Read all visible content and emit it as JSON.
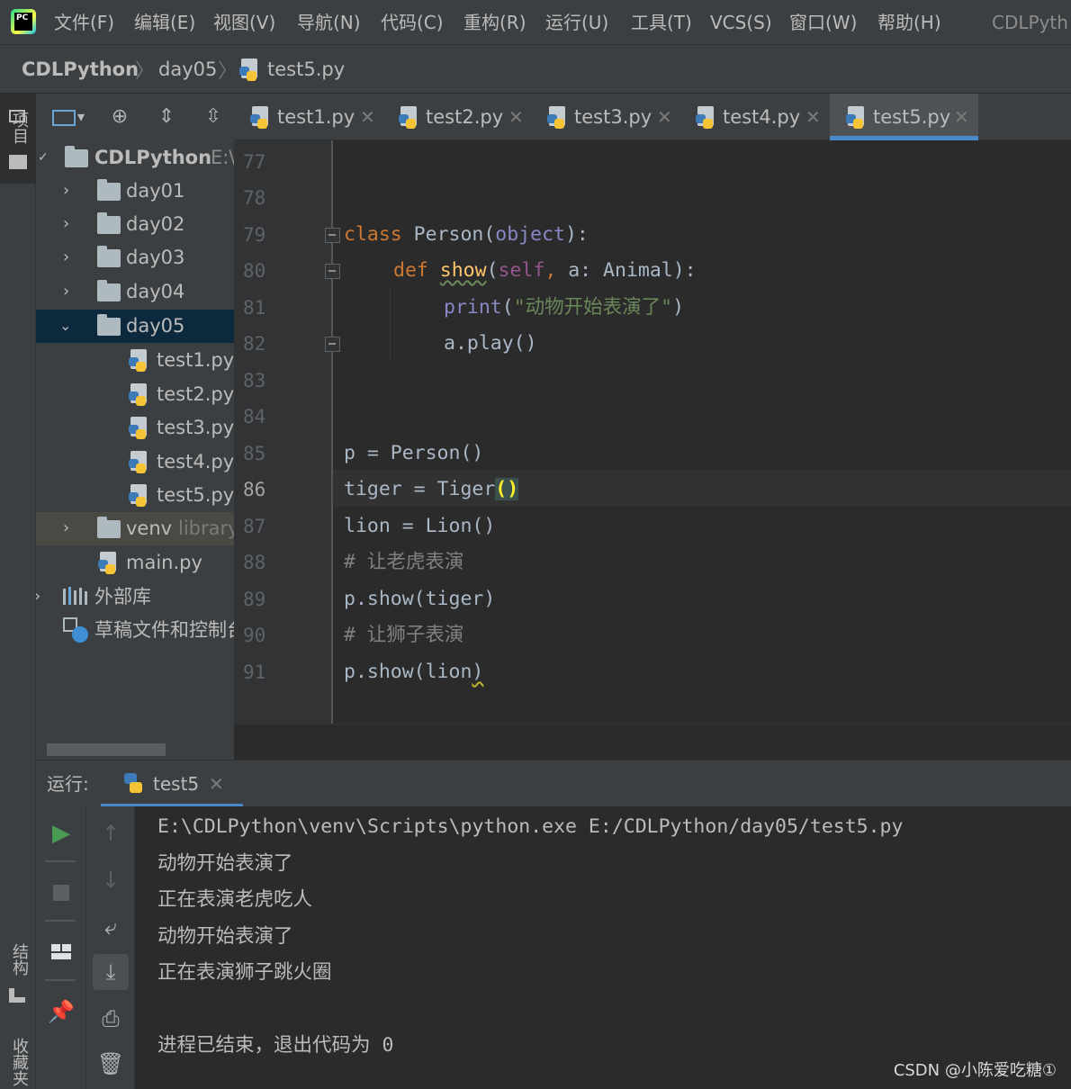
{
  "app": {
    "logo_text": "PC",
    "title": "CDLPyth"
  },
  "menu": [
    "文件(F)",
    "编辑(E)",
    "视图(V)",
    "导航(N)",
    "代码(C)",
    "重构(R)",
    "运行(U)",
    "工具(T)",
    "VCS(S)",
    "窗口(W)",
    "帮助(H)"
  ],
  "breadcrumb": [
    "CDLPython",
    "day05",
    "test5.py"
  ],
  "left_stripe": {
    "project": "项目",
    "structure": "结构",
    "bookmarks": "收藏夹"
  },
  "project_tree": {
    "root": {
      "label": "CDLPython",
      "path": "E:\\"
    },
    "folders": [
      "day01",
      "day02",
      "day03",
      "day04"
    ],
    "open_folder": "day05",
    "files": [
      "test1.py",
      "test2.py",
      "test3.py",
      "test4.py",
      "test5.py"
    ],
    "venv": {
      "label": "venv",
      "hint": "library"
    },
    "main": "main.py",
    "external_libs": "外部库",
    "scratches": "草稿文件和控制台"
  },
  "tabs": [
    {
      "label": "test1.py",
      "active": false
    },
    {
      "label": "test2.py",
      "active": false
    },
    {
      "label": "test3.py",
      "active": false
    },
    {
      "label": "test4.py",
      "active": false
    },
    {
      "label": "test5.py",
      "active": true
    }
  ],
  "editor": {
    "line_numbers": [
      "77",
      "78",
      "79",
      "80",
      "81",
      "82",
      "83",
      "84",
      "85",
      "86",
      "87",
      "88",
      "89",
      "90",
      "91"
    ],
    "current_line": "86",
    "tokens": {
      "kw_class": "class",
      "person_decl": " Person(",
      "object": "object",
      "close_colon": "):",
      "kw_def": "def",
      "show": "show",
      "open_paren": "(",
      "self": "self",
      "comma": ",",
      "param": " a: Animal):",
      "print": "print",
      "print_open": "(",
      "string": "\"动物开始表演了\"",
      "print_close": ")",
      "a_play": "a.play()",
      "p_assign": "p = Person()",
      "tiger_assign": "tiger = Tiger",
      "tiger_parens": "()",
      "lion_assign": "lion = Lion()",
      "comment_tiger": "# 让老虎表演",
      "show_tiger": "p.show(tiger)",
      "comment_lion": "# 让狮子表演",
      "show_lion_a": "p.show(lion",
      "show_lion_b": ")"
    }
  },
  "run": {
    "label": "运行:",
    "tab": "test5",
    "output": [
      "E:\\CDLPython\\venv\\Scripts\\python.exe E:/CDLPython/day05/test5.py",
      "动物开始表演了",
      "正在表演老虎吃人",
      "动物开始表演了",
      "正在表演狮子跳火圈",
      "",
      "进程已结束，退出代码为 0"
    ]
  },
  "watermark": "CSDN @小陈爱吃糖①",
  "colors": {
    "keyword": "#cc7832",
    "function": "#ffc66d",
    "builtin": "#8888c6",
    "self": "#94558d",
    "string": "#6a8759",
    "comment": "#808080",
    "accent": "#4a88c7",
    "run_green": "#499c54"
  }
}
